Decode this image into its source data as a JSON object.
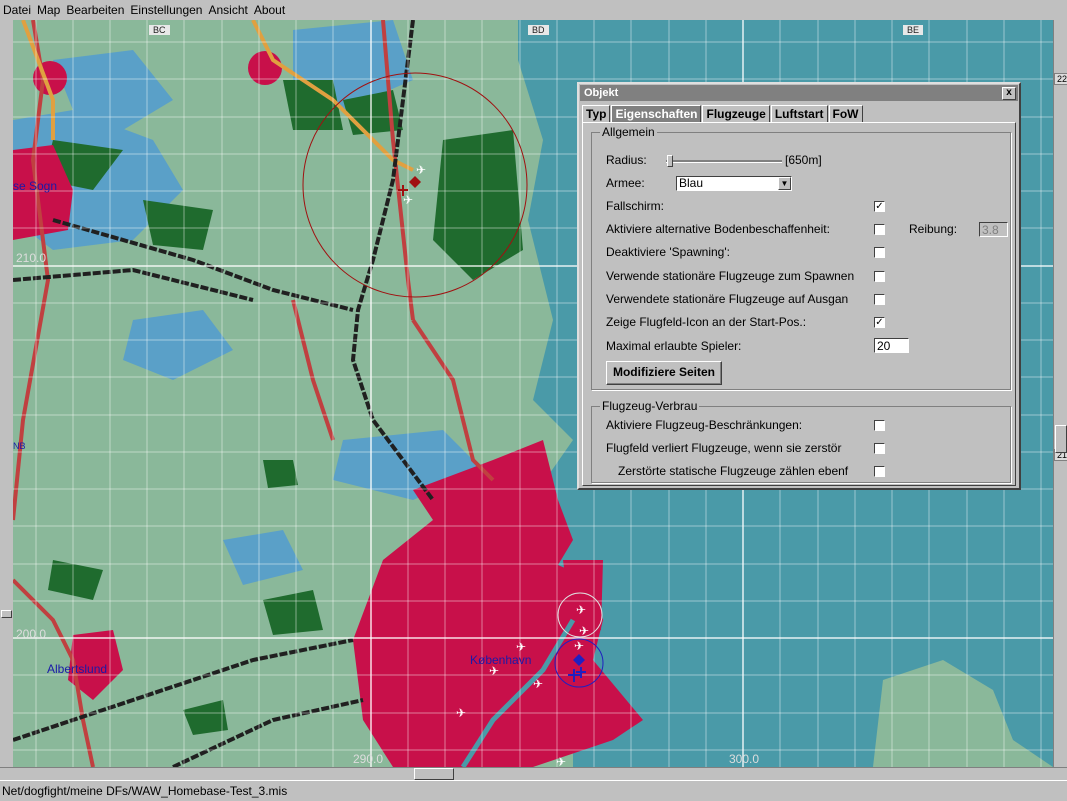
{
  "menubar": {
    "items": [
      "Datei",
      "Map",
      "Bearbeiten",
      "Einstellungen",
      "Ansicht",
      "About"
    ]
  },
  "map": {
    "column_labels": [
      "BC",
      "BD",
      "BE"
    ],
    "row_labels": [
      "22",
      "21"
    ],
    "left_markers": [
      "NB"
    ],
    "coord_labels": {
      "y210": "210.0",
      "y200": "200.0",
      "x290": "290.0",
      "x300": "300.0"
    },
    "places": {
      "sogn": "se Sogn",
      "albertslund": "Albertslund",
      "kobenhavn": "København"
    },
    "colors": {
      "land": "#8ab89a",
      "water": "#4a9aa8",
      "forest": "#1f6b2e",
      "urban": "#c8104a",
      "lake": "#5aa0c8",
      "road_red": "#c04040",
      "road_orange": "#e0a040",
      "rail": "#202020"
    }
  },
  "dialog": {
    "title": "Objekt",
    "close": "x",
    "tabs": [
      "Typ",
      "Eigenschaften",
      "Flugzeuge",
      "Luftstart",
      "FoW"
    ],
    "active_tab": "Eigenschaften",
    "allgemein": {
      "title": "Allgemein",
      "radius_label": "Radius:",
      "radius_value": "[650m]",
      "armee_label": "Armee:",
      "armee_value": "Blau",
      "fallschirm": "Fallschirm:",
      "fallschirm_checked": "✓",
      "bodenbeschaffenheit": "Aktiviere alternative Bodenbeschaffenheit:",
      "reibung_label": "Reibung:",
      "reibung_value": "3.8",
      "spawning": "Deaktiviere 'Spawning':",
      "stationaer_spawn": "Verwende stationäre Flugzeuge zum Spawnen",
      "stationaer_ausgang": "Verwendete stationäre Flugzeuge auf Ausgan",
      "flugfeld_icon": "Zeige Flugfeld-Icon an der Start-Pos.:",
      "flugfeld_icon_checked": "✓",
      "max_spieler_label": "Maximal erlaubte Spieler:",
      "max_spieler_value": "20",
      "modify_button": "Modifiziere Seiten"
    },
    "verbrauch": {
      "title": "Flugzeug-Verbrau",
      "beschraenkungen": "Aktiviere Flugzeug-Beschränkungen:",
      "verliert": "Flugfeld verliert Flugzeuge, wenn sie zerstör",
      "zerstoerte": "Zerstörte statische Flugzeuge zählen ebenf"
    }
  },
  "statusbar": {
    "path": "Net/dogfight/meine DFs/WAW_Homebase-Test_3.mis"
  }
}
